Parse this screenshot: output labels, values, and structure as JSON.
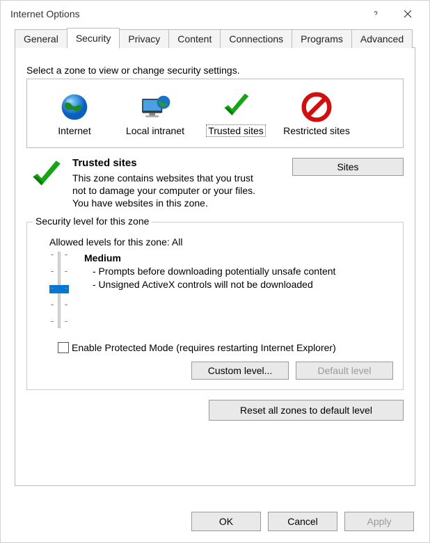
{
  "window": {
    "title": "Internet Options"
  },
  "tabs": {
    "items": [
      {
        "label": "General"
      },
      {
        "label": "Security"
      },
      {
        "label": "Privacy"
      },
      {
        "label": "Content"
      },
      {
        "label": "Connections"
      },
      {
        "label": "Programs"
      },
      {
        "label": "Advanced"
      }
    ],
    "active_index": 1
  },
  "security": {
    "instruction": "Select a zone to view or change security settings.",
    "zones": [
      {
        "label": "Internet",
        "icon": "globe"
      },
      {
        "label": "Local intranet",
        "icon": "monitor-globe"
      },
      {
        "label": "Trusted sites",
        "icon": "check"
      },
      {
        "label": "Restricted sites",
        "icon": "prohibit"
      }
    ],
    "selected_zone_index": 2,
    "detail": {
      "title": "Trusted sites",
      "line1": "This zone contains websites that you trust not to damage your computer or your files.",
      "line2": "You have websites in this zone.",
      "sites_button": "Sites"
    },
    "group_legend": "Security level for this zone",
    "allowed_label": "Allowed levels for this zone: All",
    "level": {
      "name": "Medium",
      "bullet1": "- Prompts before downloading potentially unsafe content",
      "bullet2": "- Unsigned ActiveX controls will not be downloaded"
    },
    "checkbox_label": "Enable Protected Mode (requires restarting Internet Explorer)",
    "checkbox_checked": false,
    "custom_level_button": "Custom level...",
    "default_level_button": "Default level",
    "default_level_enabled": false,
    "reset_button": "Reset all zones to default level"
  },
  "dialog_buttons": {
    "ok": "OK",
    "cancel": "Cancel",
    "apply": "Apply",
    "apply_enabled": false
  }
}
